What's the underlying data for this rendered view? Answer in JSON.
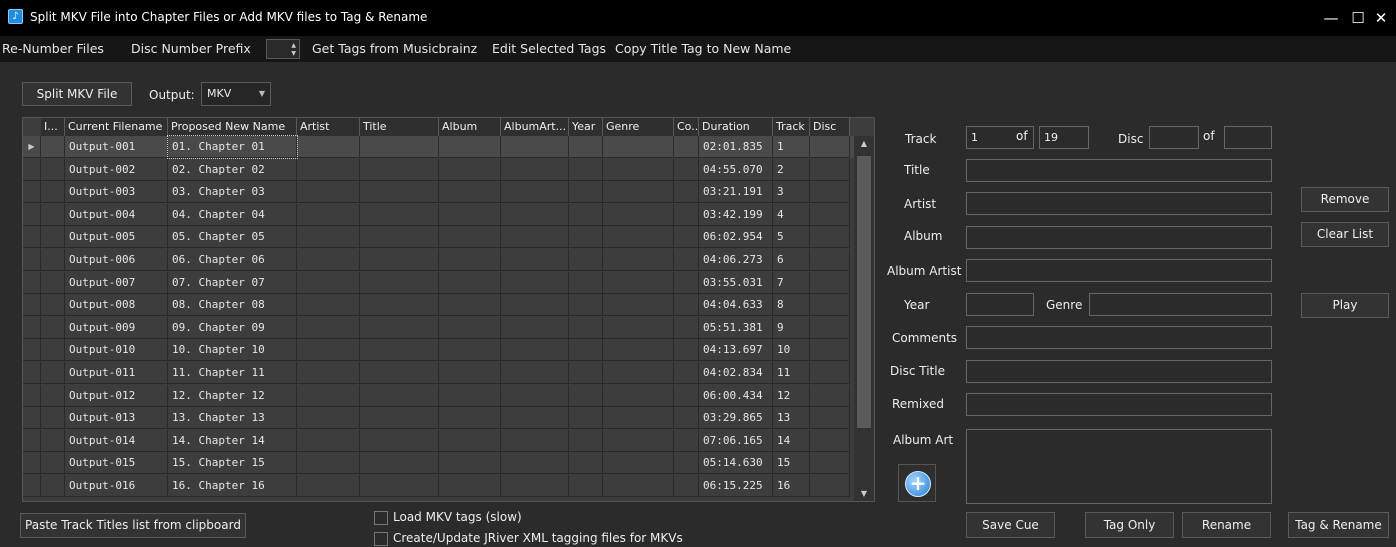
{
  "window": {
    "title": "Split MKV File into Chapter Files or Add MKV files to Tag & Rename",
    "minimize": "—",
    "maximize": "☐",
    "close": "✕"
  },
  "menu": {
    "renumber": "Re-Number Files",
    "disc_prefix": "Disc Number Prefix",
    "musicbrainz": "Get Tags from Musicbrainz",
    "edit_tags": "Edit Selected Tags",
    "copy_title": "Copy Title Tag to New Name"
  },
  "toolbar": {
    "split_button": "Split MKV File",
    "output_label": "Output:",
    "output_value": "MKV"
  },
  "grid": {
    "columns": [
      "I...",
      "Current Filename",
      "Proposed New Name",
      "Artist",
      "Title",
      "Album",
      "AlbumArt...",
      "Year",
      "Genre",
      "Co...",
      "Duration",
      "Track",
      "Disc"
    ],
    "selected_row": 0,
    "rows": [
      {
        "file": "Output-001",
        "name": "01. Chapter 01",
        "duration": "02:01.835",
        "track": "1"
      },
      {
        "file": "Output-002",
        "name": "02. Chapter 02",
        "duration": "04:55.070",
        "track": "2"
      },
      {
        "file": "Output-003",
        "name": "03. Chapter 03",
        "duration": "03:21.191",
        "track": "3"
      },
      {
        "file": "Output-004",
        "name": "04. Chapter 04",
        "duration": "03:42.199",
        "track": "4"
      },
      {
        "file": "Output-005",
        "name": "05. Chapter 05",
        "duration": "06:02.954",
        "track": "5"
      },
      {
        "file": "Output-006",
        "name": "06. Chapter 06",
        "duration": "04:06.273",
        "track": "6"
      },
      {
        "file": "Output-007",
        "name": "07. Chapter 07",
        "duration": "03:55.031",
        "track": "7"
      },
      {
        "file": "Output-008",
        "name": "08. Chapter 08",
        "duration": "04:04.633",
        "track": "8"
      },
      {
        "file": "Output-009",
        "name": "09. Chapter 09",
        "duration": "05:51.381",
        "track": "9"
      },
      {
        "file": "Output-010",
        "name": "10. Chapter 10",
        "duration": "04:13.697",
        "track": "10"
      },
      {
        "file": "Output-011",
        "name": "11. Chapter 11",
        "duration": "04:02.834",
        "track": "11"
      },
      {
        "file": "Output-012",
        "name": "12. Chapter 12",
        "duration": "06:00.434",
        "track": "12"
      },
      {
        "file": "Output-013",
        "name": "13. Chapter 13",
        "duration": "03:29.865",
        "track": "13"
      },
      {
        "file": "Output-014",
        "name": "14. Chapter 14",
        "duration": "07:06.165",
        "track": "14"
      },
      {
        "file": "Output-015",
        "name": "15. Chapter 15",
        "duration": "05:14.630",
        "track": "15"
      },
      {
        "file": "Output-016",
        "name": "16. Chapter 16",
        "duration": "06:15.225",
        "track": "16"
      }
    ]
  },
  "tags": {
    "track_label": "Track",
    "track_value": "1",
    "of_label": "of",
    "track_total": "19",
    "disc_label": "Disc",
    "disc_value": "",
    "disc_total": "",
    "title_label": "Title",
    "artist_label": "Artist",
    "album_label": "Album",
    "album_artist_label": "Album Artist",
    "year_label": "Year",
    "genre_label": "Genre",
    "comments_label": "Comments",
    "disc_title_label": "Disc Title",
    "remixed_label": "Remixed",
    "album_art_label": "Album Art"
  },
  "side_buttons": {
    "remove": "Remove",
    "clear": "Clear List",
    "play": "Play"
  },
  "bottom": {
    "paste": "Paste Track Titles list from clipboard",
    "load_tags": "Load MKV tags (slow)",
    "jriver": "Create/Update JRiver XML tagging files for MKVs",
    "save_cue": "Save Cue",
    "tag_only": "Tag Only",
    "rename": "Rename",
    "tag_rename": "Tag & Rename"
  }
}
